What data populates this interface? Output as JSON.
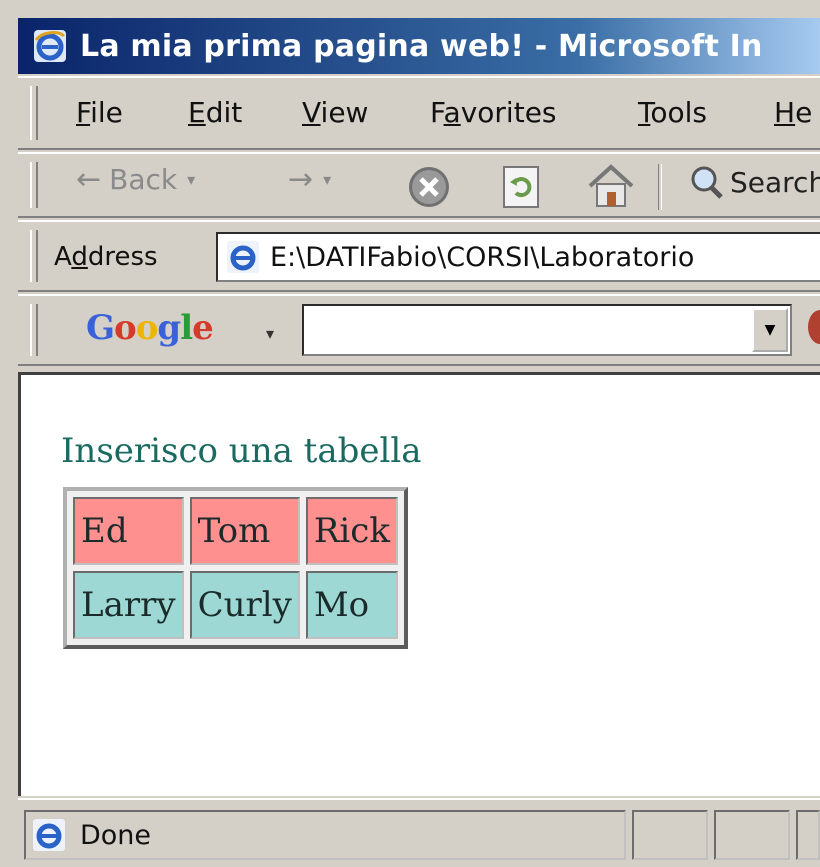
{
  "window": {
    "title": "La mia prima pagina web! - Microsoft In",
    "icon": "ie-icon"
  },
  "menu": {
    "file": "File",
    "edit": "Edit",
    "view": "View",
    "favorites": "Favorites",
    "tools": "Tools",
    "help": "He"
  },
  "toolbar": {
    "back_label": "Back",
    "search_label": "Search",
    "icons": [
      "back-arrow-icon",
      "forward-arrow-icon",
      "stop-icon",
      "refresh-icon",
      "home-icon",
      "search-icon"
    ]
  },
  "address": {
    "label": "Address",
    "value": "E:\\DATIFabio\\CORSI\\Laboratorio"
  },
  "google": {
    "logo": "Google",
    "search_value": "",
    "colors": [
      "#3a62d8",
      "#d53a2a",
      "#f0b400",
      "#3a62d8",
      "#2a9a3a",
      "#d53a2a"
    ]
  },
  "page": {
    "heading": "Inserisco una tabella",
    "table": {
      "rows": [
        {
          "color": "#ff9090",
          "cells": [
            "Ed",
            "Tom",
            "Rick"
          ]
        },
        {
          "color": "#9ed8d4",
          "cells": [
            "Larry",
            "Curly",
            "Mo"
          ]
        }
      ]
    }
  },
  "status": {
    "text": "Done"
  }
}
